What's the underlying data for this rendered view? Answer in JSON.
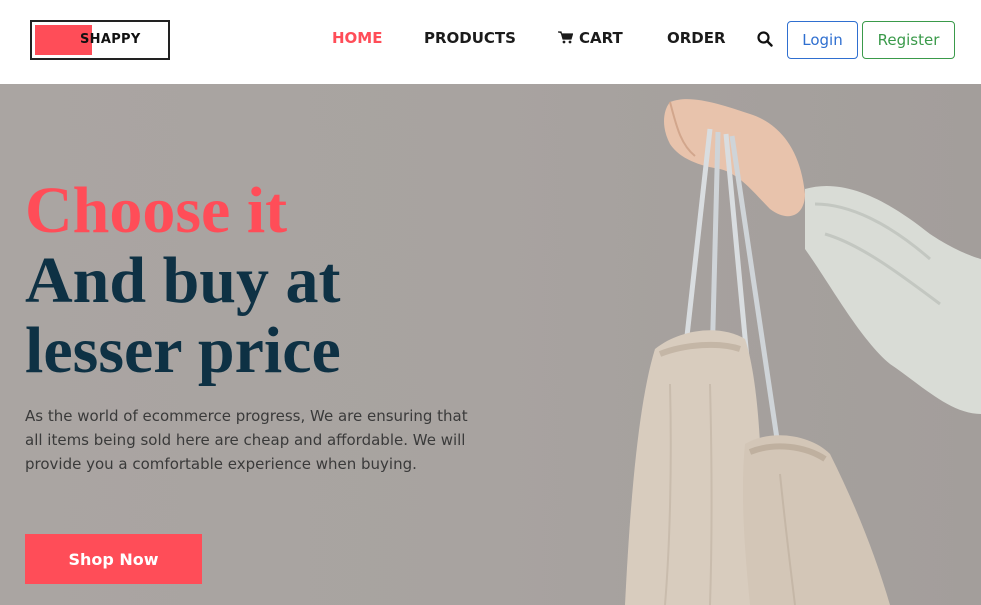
{
  "brand": {
    "logo_text": "SHAPPY",
    "accent": "#ff4d58",
    "dark": "#0e3144"
  },
  "nav": {
    "items": [
      {
        "label": "HOME",
        "active": true
      },
      {
        "label": "PRODUCTS",
        "active": false
      },
      {
        "label": "CART",
        "active": false,
        "icon": "cart-icon"
      },
      {
        "label": "ORDER",
        "active": false
      }
    ],
    "search_icon": "search-icon",
    "login_label": "Login",
    "register_label": "Register"
  },
  "hero": {
    "headline_line1": "Choose it",
    "headline_line2": "And buy at",
    "headline_line3": "lesser price",
    "description": "As the world of ecommerce progress, We are ensuring that all items being sold here are cheap and affordable. We will provide you a comfortable experience when buying.",
    "cta_label": "Shop Now"
  }
}
